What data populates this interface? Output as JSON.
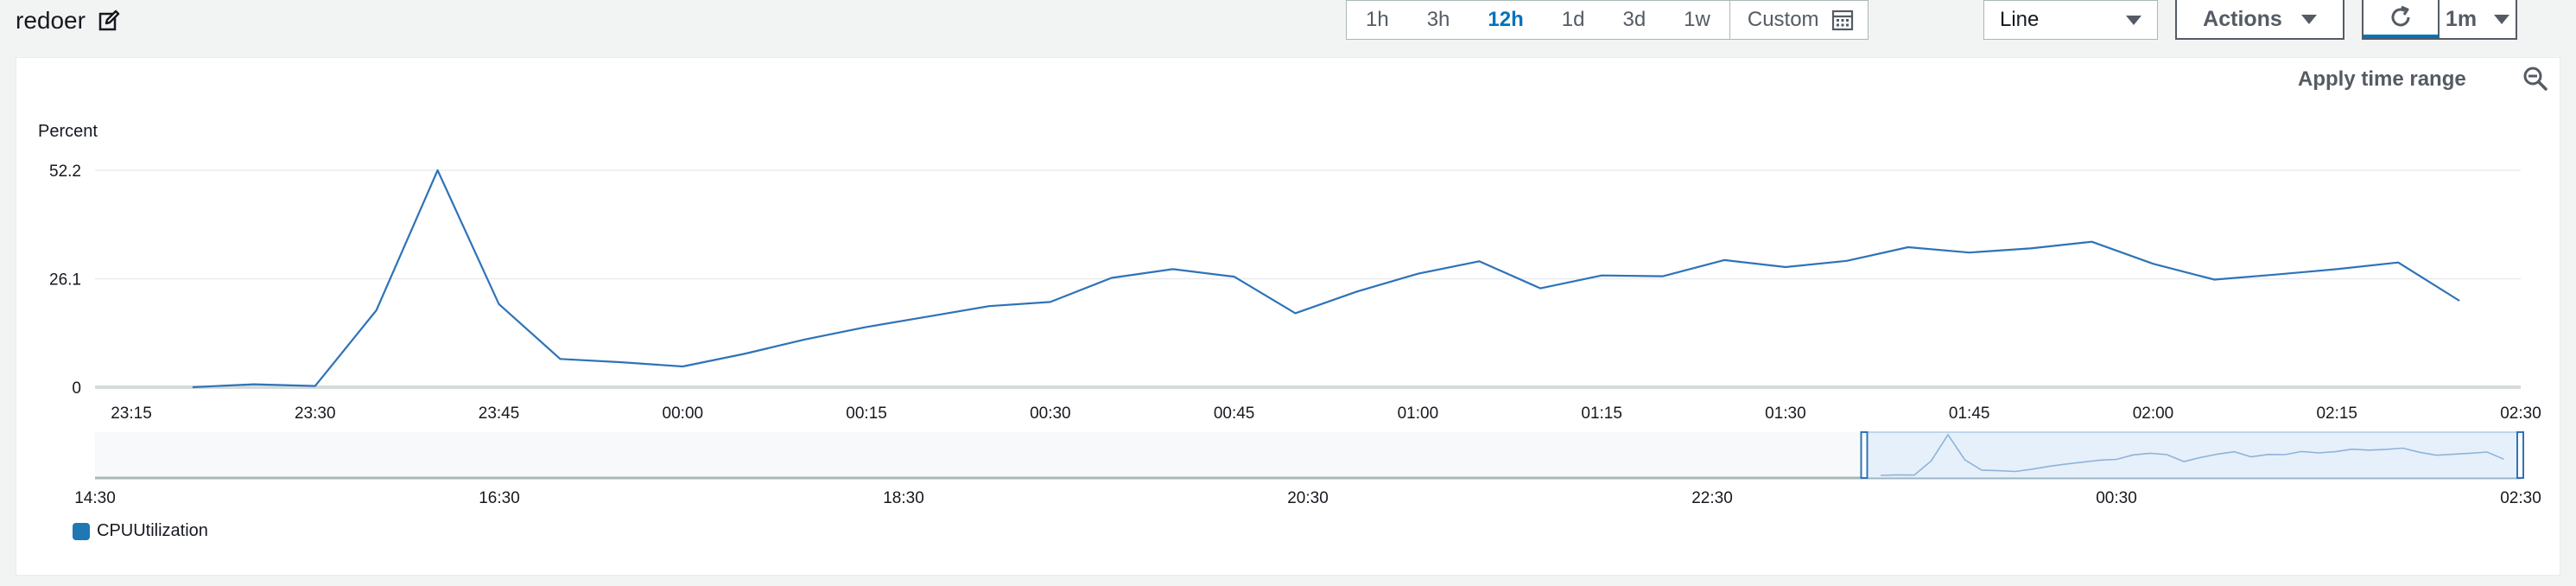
{
  "header": {
    "title": "redoer",
    "time_ranges": [
      "1h",
      "3h",
      "12h",
      "1d",
      "3d",
      "1w"
    ],
    "active_range": "12h",
    "custom_label": "Custom",
    "chart_type": "Line",
    "actions_label": "Actions",
    "refresh_interval": "1m"
  },
  "panel": {
    "apply_time_range": "Apply time range"
  },
  "colors": {
    "series": "#2e73b8",
    "accent": "#0073bb",
    "grid": "#e9ebed"
  },
  "chart_data": {
    "type": "line",
    "ylabel": "Percent",
    "yticks": [
      "0",
      "26.1",
      "52.2"
    ],
    "ylim": [
      0,
      52.2
    ],
    "xticks": [
      "23:15",
      "23:30",
      "23:45",
      "00:00",
      "00:15",
      "00:30",
      "00:45",
      "01:00",
      "01:15",
      "01:30",
      "01:45",
      "02:00",
      "02:15",
      "02:30"
    ],
    "series": [
      {
        "name": "CPUUtilization",
        "x": [
          "23:20",
          "23:25",
          "23:30",
          "23:35",
          "23:40",
          "23:45",
          "23:50",
          "23:55",
          "00:00",
          "00:05",
          "00:10",
          "00:15",
          "00:20",
          "00:25",
          "00:30",
          "00:35",
          "00:40",
          "00:45",
          "00:50",
          "00:55",
          "01:00",
          "01:05",
          "01:10",
          "01:15",
          "01:20",
          "01:25",
          "01:30",
          "01:35",
          "01:40",
          "01:45",
          "01:50",
          "01:55",
          "02:00",
          "02:05",
          "02:10",
          "02:15",
          "02:20",
          "02:25"
        ],
        "values": [
          0,
          0.7,
          0.3,
          18.5,
          52.2,
          20,
          6.8,
          6,
          5,
          8,
          11.5,
          14.5,
          17,
          19.5,
          20.5,
          26.3,
          28.4,
          26.6,
          17.8,
          23,
          27.3,
          30.3,
          23.8,
          26.9,
          26.7,
          30.6,
          28.9,
          30.4,
          33.7,
          32.4,
          33.4,
          35,
          29.7,
          25.9,
          27.1,
          28.4,
          30,
          20.8
        ]
      }
    ],
    "overview": {
      "xticks": [
        "14:30",
        "16:30",
        "18:30",
        "20:30",
        "22:30",
        "00:30",
        "02:30"
      ]
    },
    "legend": [
      "CPUUtilization"
    ]
  }
}
